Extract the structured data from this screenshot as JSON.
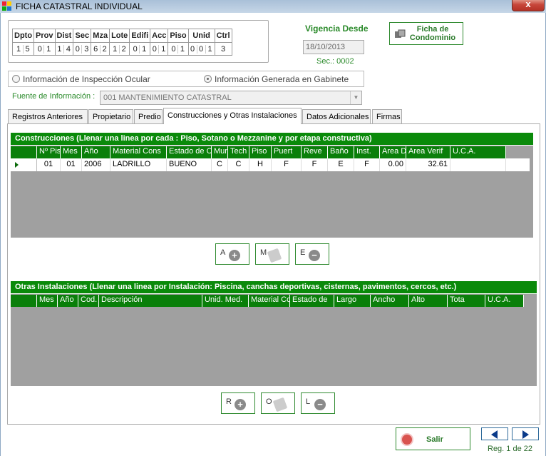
{
  "window": {
    "title": "FICHA CATASTRAL INDIVIDUAL",
    "close_label": "x"
  },
  "codes": {
    "headers": [
      "Dpto",
      "Prov",
      "Dist",
      "Sec",
      "Mza",
      "Lote",
      "Edifi",
      "Acc",
      "Piso",
      "Unid",
      "Ctrl"
    ],
    "values": [
      [
        "1",
        "5"
      ],
      [
        "0",
        "1"
      ],
      [
        "1",
        "4"
      ],
      [
        "0",
        "3"
      ],
      [
        "6",
        "2"
      ],
      [
        "1",
        "2"
      ],
      [
        "0",
        "1"
      ],
      [
        "0",
        "1"
      ],
      [
        "0",
        "1"
      ],
      [
        "0",
        "0",
        "1"
      ],
      [
        "3"
      ]
    ]
  },
  "vigencia": {
    "label": "Vigencia Desde",
    "date": "18/10/2013",
    "sec": "Sec.: 0002"
  },
  "condominio_button": {
    "label": "Ficha de Condominio"
  },
  "radios": {
    "option1": {
      "label": "Información de Inspección Ocular",
      "selected": false
    },
    "option2": {
      "label": "Información Generada en Gabinete",
      "selected": true
    }
  },
  "fuente": {
    "label": "Fuente de Información :",
    "value": "001  MANTENIMIENTO CATASTRAL"
  },
  "tabs": [
    {
      "label": "Registros Anteriores",
      "active": false
    },
    {
      "label": "Propietario",
      "active": false
    },
    {
      "label": "Predio",
      "active": false
    },
    {
      "label": "Construcciones y Otras Instalaciones",
      "active": true
    },
    {
      "label": "Datos Adicionales",
      "active": false
    },
    {
      "label": "Firmas",
      "active": false
    }
  ],
  "construcciones": {
    "title": "Construcciones (Llenar una linea por cada : Piso, Sotano o Mezzanine y por etapa constructiva)",
    "columns": [
      "Nº Pis",
      "Mes",
      "Año",
      "Material Cons",
      "Estado de Co",
      "Muro",
      "Tech",
      "Piso",
      "Puert",
      "Reve",
      "Baño",
      "Inst.",
      "Area Decl.",
      "Area Verif",
      "U.C.A."
    ],
    "rows": [
      [
        "01",
        "01",
        "2006",
        "LADRILLO",
        "BUENO",
        "C",
        "C",
        "H",
        "F",
        "F",
        "E",
        "F",
        "0.00",
        "32.61",
        ""
      ]
    ],
    "buttons": [
      {
        "label": "A",
        "icon": "plus"
      },
      {
        "label": "M",
        "icon": "edit"
      },
      {
        "label": "E",
        "icon": "minus"
      }
    ]
  },
  "otras": {
    "title": "Otras Instalaciones (Llenar una linea por Instalación: Piscina, canchas deportivas, cisternas, pavimentos, cercos, etc.)",
    "columns": [
      "Mes",
      "Año",
      "Cod.",
      "Descripción",
      "Unid. Med.",
      "Material Co",
      "Estado de",
      "Largo",
      "Ancho",
      "Alto",
      "Tota",
      "U.C.A."
    ],
    "buttons": [
      {
        "label": "R",
        "icon": "plus"
      },
      {
        "label": "O",
        "icon": "edit"
      },
      {
        "label": "L",
        "icon": "minus"
      }
    ]
  },
  "footer": {
    "salir_label": "Salir",
    "reg_label": "Reg. 1 de 22"
  }
}
